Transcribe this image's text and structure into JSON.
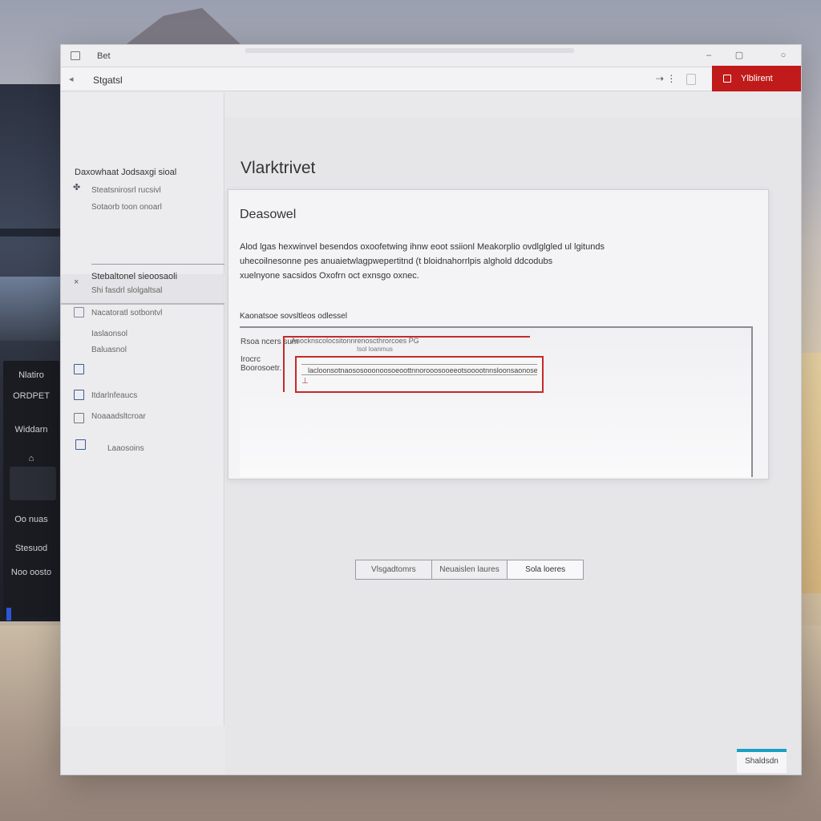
{
  "window": {
    "title": "Bet"
  },
  "toolbar": {
    "breadcrumb": "Stgatsl",
    "tool_icons": "⇢ ⋮",
    "primary_button": "Ylblirent",
    "accent_color": "#c01a1a"
  },
  "sidebar": {
    "heading": "Daxowhaat Jodsaxgi sioal",
    "items": [
      {
        "label": "Steatsnirosrl rucsivl",
        "icon": "puzzle-icon"
      },
      {
        "label": "Sotaorb toon onoarl",
        "icon": ""
      },
      {
        "label": "Stebaltonel sieoosaoli",
        "icon": "close-icon",
        "active": true
      },
      {
        "label": "Shi fasdrl slolgaltsal",
        "icon": ""
      },
      {
        "label": "Nacatoratl sotbontvl",
        "icon": "document-icon"
      },
      {
        "label": "Iaslaonsol",
        "icon": ""
      },
      {
        "label": "Baluasnol",
        "icon": ""
      },
      {
        "label": "",
        "icon": "image-icon"
      },
      {
        "label": "Itdarlnfeaucs",
        "icon": "monitor-icon"
      },
      {
        "label": "Noaaadsltcroar",
        "icon": "file-icon"
      },
      {
        "label": "Laaosoins",
        "icon": "window-icon"
      }
    ]
  },
  "main": {
    "page_title": "Vlarktrivet",
    "card": {
      "title": "Deasowel",
      "description": [
        "Alod lgas hexwinvel besendos oxoofetwing ihnw eoot ssiionl Meakorplio ovdlglgled ul lgitunds",
        "uhecoilnesonne pes anuaietwlagpwepertitnd (t bloidnahorrlpis alghold ddcodubs",
        "xuelnyone sacsidos Oxofrn oct exnsgo oxnec."
      ],
      "section_label": "Kaonatsoe sovsltleos odlessel",
      "rows": [
        {
          "label": "Rsoa ncers sum",
          "value": "Anocknscolocsitonnrenoscthrorcoes PG",
          "sub": "Isol  loanmus"
        },
        {
          "label": "Irocrc Boorosoetr.",
          "value": "lacloonsotnaososooonoosoeoottnnorooosooeeotsooootnnsloonsaonosecltsoonosooeaol"
        }
      ]
    },
    "segments": [
      "Vlsgadtomrs",
      "Neuaislen laures",
      "Sola loeres"
    ],
    "footer_button": "Shaldsdn"
  },
  "desktop": {
    "dock": [
      "Nlatiro",
      "ORDPET",
      "Widdarn",
      "",
      "",
      "Oo  nuas",
      "Stesuod",
      "Noo  oosto"
    ]
  }
}
